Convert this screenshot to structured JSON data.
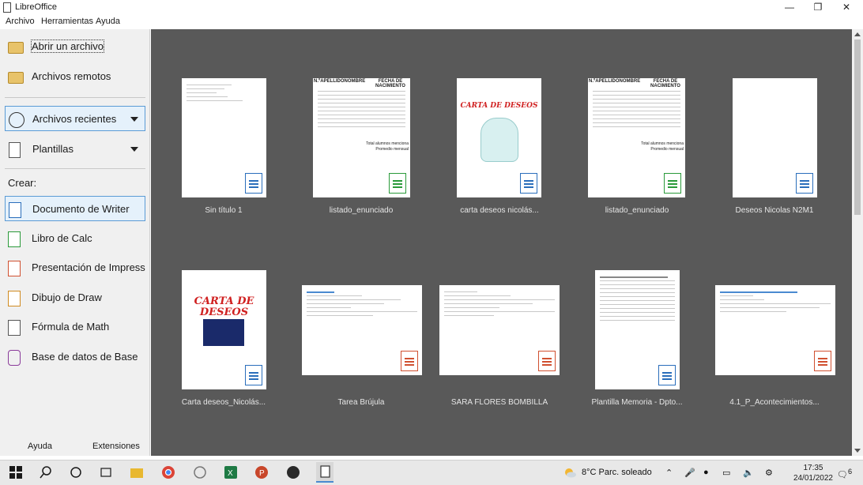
{
  "window": {
    "title": "LibreOffice"
  },
  "menu": [
    {
      "label": "Archivo"
    },
    {
      "label": "Herramientas"
    },
    {
      "label": "Ayuda"
    }
  ],
  "sidebar": {
    "open_file": "Abrir un archivo",
    "remote_files": "Archivos remotos",
    "recent_files": "Archivos recientes",
    "templates": "Plantillas",
    "create_label": "Crear:",
    "create": [
      {
        "label": "Documento de Writer",
        "icon": "writer-icon"
      },
      {
        "label": "Libro de Calc",
        "icon": "calc-icon"
      },
      {
        "label": "Presentación de Impress",
        "icon": "impress-icon"
      },
      {
        "label": "Dibujo de Draw",
        "icon": "draw-icon"
      },
      {
        "label": "Fórmula de Math",
        "icon": "math-icon"
      },
      {
        "label": "Base de datos de Base",
        "icon": "base-icon"
      }
    ],
    "help": "Ayuda",
    "extensions": "Extensiones"
  },
  "recent": [
    {
      "name": "Sin título 1",
      "type": "writer"
    },
    {
      "name": "listado_enunciado",
      "type": "calc"
    },
    {
      "name": "carta deseos nicolás...",
      "type": "writer"
    },
    {
      "name": "listado_enunciado",
      "type": "calc"
    },
    {
      "name": "Deseos Nicolas N2M1",
      "type": "writer"
    },
    {
      "name": "Carta deseos_Nicolás...",
      "type": "writer"
    },
    {
      "name": "Tarea Brújula",
      "type": "impress"
    },
    {
      "name": "SARA FLORES BOMBILLA",
      "type": "impress"
    },
    {
      "name": "Plantilla Memoria - Dpto...",
      "type": "writer"
    },
    {
      "name": "4.1_P_Acontecimientos...",
      "type": "impress"
    }
  ],
  "thumb_text": {
    "calc_header_1": "N.ºAPELLIDONOMBRE",
    "calc_header_2": "FECHA DE NACIMIENTO",
    "calc_footer_1": "Total alumnos menciona",
    "calc_footer_2": "Promedio mensual",
    "carta_title": "CARTA DE DESEOS",
    "carta_title_2a": "CARTA DE",
    "carta_title_2b": "DESEOS"
  },
  "taskbar": {
    "weather": "8°C  Parc. soleado",
    "time": "17:35",
    "date": "24/01/2022",
    "notifications": "6"
  }
}
